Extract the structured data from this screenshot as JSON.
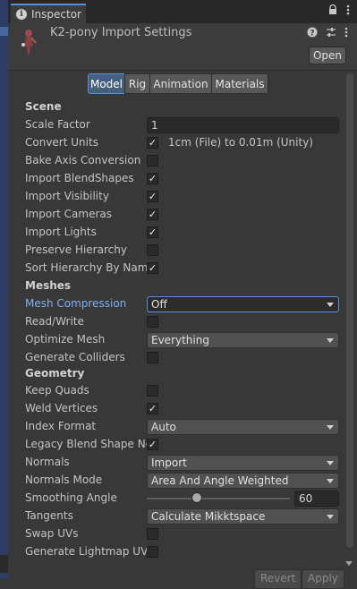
{
  "tab": {
    "title": "Inspector"
  },
  "header": {
    "title": "K2-pony Import Settings",
    "open_label": "Open"
  },
  "toolbar": {
    "tabs": [
      "Model",
      "Rig",
      "Animation",
      "Materials"
    ]
  },
  "scene": {
    "section": "Scene",
    "scale_factor": {
      "label": "Scale Factor",
      "value": "1"
    },
    "convert_units": {
      "label": "Convert Units",
      "checked": true,
      "note": "1cm (File) to 0.01m (Unity)"
    },
    "bake_axis_conversion": {
      "label": "Bake Axis Conversion",
      "checked": false
    },
    "import_blendshapes": {
      "label": "Import BlendShapes",
      "checked": true
    },
    "import_visibility": {
      "label": "Import Visibility",
      "checked": true
    },
    "import_cameras": {
      "label": "Import Cameras",
      "checked": true
    },
    "import_lights": {
      "label": "Import Lights",
      "checked": true
    },
    "preserve_hierarchy": {
      "label": "Preserve Hierarchy",
      "checked": false
    },
    "sort_hierarchy": {
      "label": "Sort Hierarchy By Name",
      "checked": true
    }
  },
  "meshes": {
    "section": "Meshes",
    "mesh_compression": {
      "label": "Mesh Compression",
      "value": "Off"
    },
    "read_write": {
      "label": "Read/Write",
      "checked": false
    },
    "optimize_mesh": {
      "label": "Optimize Mesh",
      "value": "Everything"
    },
    "generate_colliders": {
      "label": "Generate Colliders",
      "checked": false
    }
  },
  "geometry": {
    "section": "Geometry",
    "keep_quads": {
      "label": "Keep Quads",
      "checked": false
    },
    "weld_vertices": {
      "label": "Weld Vertices",
      "checked": true
    },
    "index_format": {
      "label": "Index Format",
      "value": "Auto"
    },
    "legacy_blend": {
      "label": "Legacy Blend Shape Normals",
      "checked": true
    },
    "normals": {
      "label": "Normals",
      "value": "Import"
    },
    "normals_mode": {
      "label": "Normals Mode",
      "value": "Area And Angle Weighted"
    },
    "smoothing_angle": {
      "label": "Smoothing Angle",
      "value": "60",
      "fraction": 0.33
    },
    "tangents": {
      "label": "Tangents",
      "value": "Calculate Mikktspace"
    },
    "swap_uvs": {
      "label": "Swap UVs",
      "checked": false
    },
    "generate_lightmap_uvs": {
      "label": "Generate Lightmap UVs",
      "checked": false
    }
  },
  "footer": {
    "revert_label": "Revert",
    "apply_label": "Apply"
  },
  "icons": {
    "check": "✓",
    "lock": "lock-icon",
    "menu": "kebab-menu-icon",
    "help": "help-icon",
    "presets": "presets-icon"
  }
}
